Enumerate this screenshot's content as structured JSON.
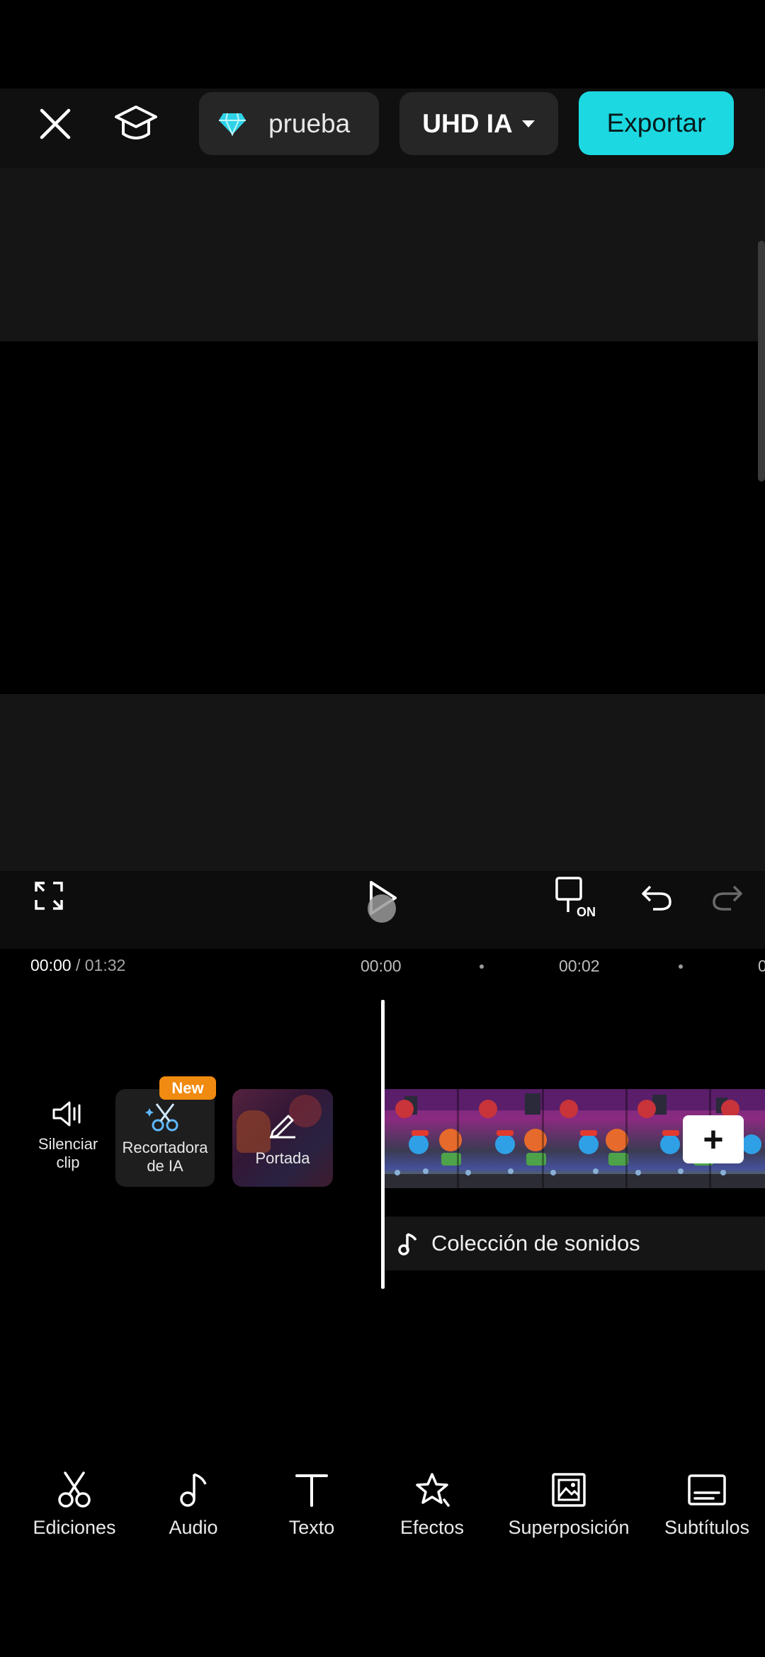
{
  "topbar": {
    "project_name": "prueba",
    "quality_label": "UHD IA",
    "export_label": "Exportar",
    "colors": {
      "export_bg": "#1cd8e0",
      "diamond": "#2fd3e8"
    }
  },
  "timecode": {
    "current": "00:00",
    "total": "/ 01:32"
  },
  "ruler": {
    "ticks": [
      "00:00",
      "00:02",
      "0"
    ]
  },
  "timeline": {
    "mute_label": "Silenciar clip",
    "ai_cutout_label": "Recortadora de IA",
    "new_badge": "New",
    "cover_label": "Portada",
    "sound_label": "Colección de sonidos"
  },
  "toolbar": {
    "items": [
      {
        "label": "Ediciones",
        "icon": "scissors-icon"
      },
      {
        "label": "Audio",
        "icon": "music-note-icon"
      },
      {
        "label": "Texto",
        "icon": "text-icon"
      },
      {
        "label": "Efectos",
        "icon": "effects-star-icon"
      },
      {
        "label": "Superposición",
        "icon": "overlay-image-icon"
      },
      {
        "label": "Subtítulos",
        "icon": "subtitles-icon"
      }
    ]
  }
}
